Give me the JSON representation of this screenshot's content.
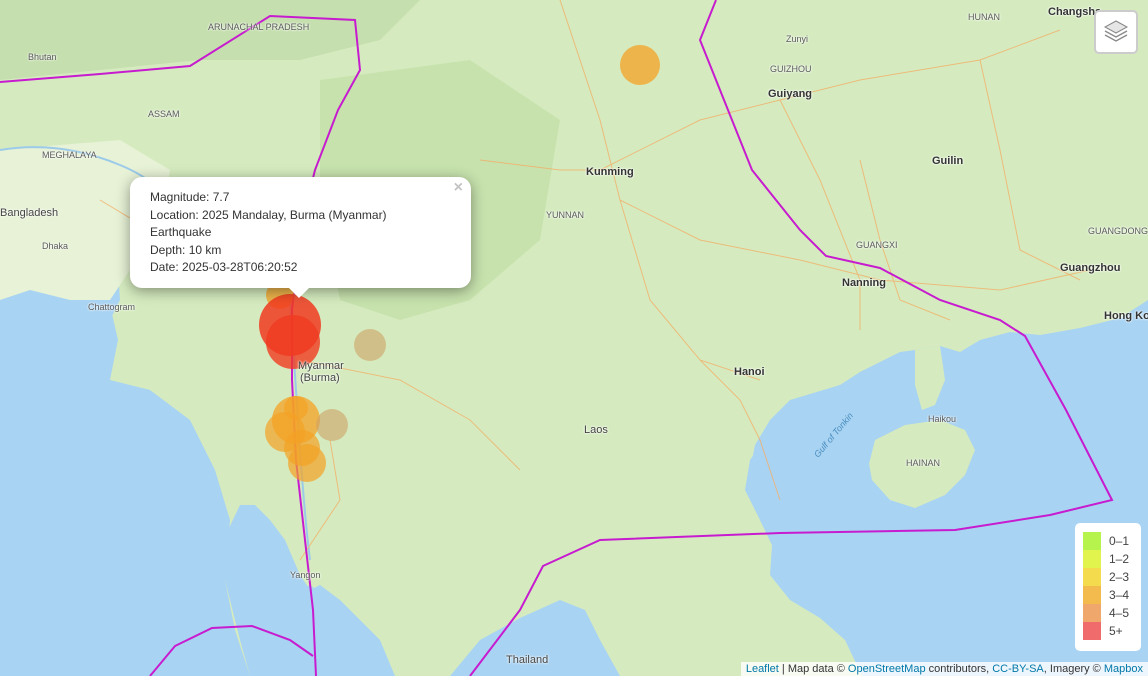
{
  "map": {
    "places": {
      "bangladesh": "Bangladesh",
      "myanmar": "Myanmar",
      "myanmar_sub": "(Burma)",
      "laos": "Laos",
      "thailand": "Thailand",
      "bhutan": "Bhutan",
      "dhaka": "Dhaka",
      "chattogram": "Chattogram",
      "yangon": "Yangon",
      "kunming": "Kunming",
      "guiyang": "Guiyang",
      "nanning": "Nanning",
      "guangzhou": "Guangzhou",
      "hong_kong": "Hong Kong",
      "hanoi": "Hanoi",
      "haikou": "Haikou",
      "changsha": "Changsha",
      "guilin": "Guilin",
      "zunyi": "Zunyi",
      "meghalaya": "MEGHALAYA",
      "assam": "ASSAM",
      "yunnan": "YUNNAN",
      "guangxi": "GUANGXI",
      "guangdong": "GUANGDONG",
      "guizhou": "GUIZHOU",
      "hunan": "HUNAN",
      "hainan": "HAINAN",
      "gulf": "Gulf of Tonkin",
      "arunachal": "ARUNACHAL PRADESH"
    }
  },
  "earthquakes": [
    {
      "magnitude": 7.7,
      "color": "#f03b20"
    },
    {
      "magnitude": 5.0,
      "color": "#f03b20"
    },
    {
      "magnitude": 3.5,
      "color": "#f4a124"
    },
    {
      "magnitude": 3.0,
      "color": "#cfa266"
    }
  ],
  "popup": {
    "magnitude": "Magnitude: 7.7",
    "location": "Location: 2025 Mandalay, Burma (Myanmar)",
    "location_cont": "Earthquake",
    "depth": "Depth: 10 km",
    "date": "Date: 2025-03-28T06:20:52",
    "close": "×"
  },
  "legend": [
    {
      "label": "0–1",
      "color": "#b7f34d"
    },
    {
      "label": "1–2",
      "color": "#e1f34d"
    },
    {
      "label": "2–3",
      "color": "#f3db4d"
    },
    {
      "label": "3–4",
      "color": "#f3ba4d"
    },
    {
      "label": "4–5",
      "color": "#f0a76b"
    },
    {
      "label": "5+",
      "color": "#f06b6b"
    }
  ],
  "attribution": {
    "leaflet": "Leaflet",
    "sep1": " | Map data © ",
    "osm": "OpenStreetMap",
    "contributors": " contributors, ",
    "ccbysa": "CC-BY-SA",
    "imagery": ", Imagery © ",
    "mapbox": "Mapbox"
  },
  "colors": {
    "plate_boundary": "#c71bcf",
    "land": "#d7ecc2",
    "water": "#a9d3f2",
    "road": "#f2a65a"
  },
  "icons": {
    "layers": "layers-icon",
    "close": "close-icon"
  }
}
